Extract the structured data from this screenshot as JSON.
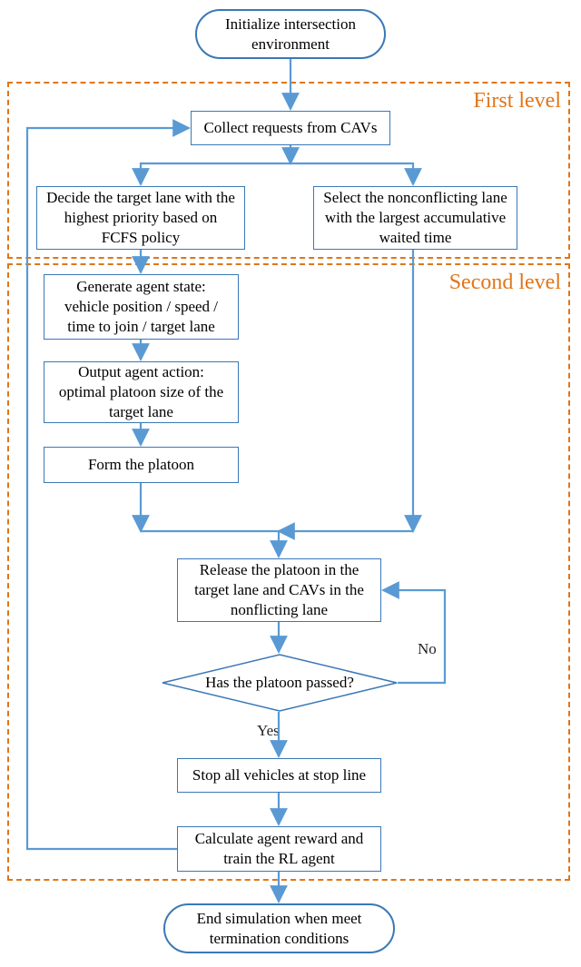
{
  "nodes": {
    "start": "Initialize intersection environment",
    "collect": "Collect requests from CAVs",
    "decide_lane": "Decide the target lane with the highest priority based on FCFS policy",
    "select_nonconf": "Select the nonconflicting lane with the largest accumulative waited time",
    "gen_state": "Generate agent state: vehicle position / speed / time to join / target lane",
    "output_action": "Output agent action: optimal platoon size of the target lane",
    "form_platoon": "Form the platoon",
    "release": "Release the platoon in the target lane and CAVs in the nonflicting lane",
    "decision": "Has the platoon passed?",
    "stop_all": "Stop all vehicles at stop line",
    "calc_reward": "Calculate agent reward and train the RL agent",
    "end": "End simulation when meet termination conditions"
  },
  "labels": {
    "yes": "Yes",
    "no": "No",
    "first_level": "First level",
    "second_level": "Second level"
  },
  "chart_data": {
    "type": "flowchart",
    "title": "",
    "levels": [
      {
        "name": "First level",
        "contains": [
          "collect",
          "decide_lane",
          "select_nonconf"
        ]
      },
      {
        "name": "Second level",
        "contains": [
          "gen_state",
          "output_action",
          "form_platoon",
          "release",
          "decision",
          "stop_all",
          "calc_reward"
        ]
      }
    ],
    "nodes": [
      {
        "id": "start",
        "type": "terminator",
        "text": "Initialize intersection environment"
      },
      {
        "id": "collect",
        "type": "process",
        "text": "Collect requests from CAVs"
      },
      {
        "id": "decide_lane",
        "type": "process",
        "text": "Decide the target lane with the highest priority based on FCFS policy"
      },
      {
        "id": "select_nonconf",
        "type": "process",
        "text": "Select the nonconflicting lane with the largest accumulative waited time"
      },
      {
        "id": "gen_state",
        "type": "process",
        "text": "Generate agent state: vehicle position / speed / time to join / target lane"
      },
      {
        "id": "output_action",
        "type": "process",
        "text": "Output agent action: optimal platoon size of the target lane"
      },
      {
        "id": "form_platoon",
        "type": "process",
        "text": "Form the platoon"
      },
      {
        "id": "release",
        "type": "process",
        "text": "Release the platoon in the target lane and CAVs in the nonflicting lane"
      },
      {
        "id": "decision",
        "type": "decision",
        "text": "Has the platoon passed?"
      },
      {
        "id": "stop_all",
        "type": "process",
        "text": "Stop all vehicles at stop line"
      },
      {
        "id": "calc_reward",
        "type": "process",
        "text": "Calculate agent reward and train the RL agent"
      },
      {
        "id": "end",
        "type": "terminator",
        "text": "End simulation when meet termination conditions"
      }
    ],
    "edges": [
      {
        "from": "start",
        "to": "collect"
      },
      {
        "from": "collect",
        "to": "decide_lane"
      },
      {
        "from": "collect",
        "to": "select_nonconf"
      },
      {
        "from": "decide_lane",
        "to": "gen_state"
      },
      {
        "from": "gen_state",
        "to": "output_action"
      },
      {
        "from": "output_action",
        "to": "form_platoon"
      },
      {
        "from": "form_platoon",
        "to": "release"
      },
      {
        "from": "select_nonconf",
        "to": "release"
      },
      {
        "from": "release",
        "to": "decision"
      },
      {
        "from": "decision",
        "to": "stop_all",
        "label": "Yes"
      },
      {
        "from": "decision",
        "to": "release",
        "label": "No"
      },
      {
        "from": "stop_all",
        "to": "calc_reward"
      },
      {
        "from": "calc_reward",
        "to": "collect",
        "loop": true
      },
      {
        "from": "calc_reward",
        "to": "end"
      }
    ]
  }
}
